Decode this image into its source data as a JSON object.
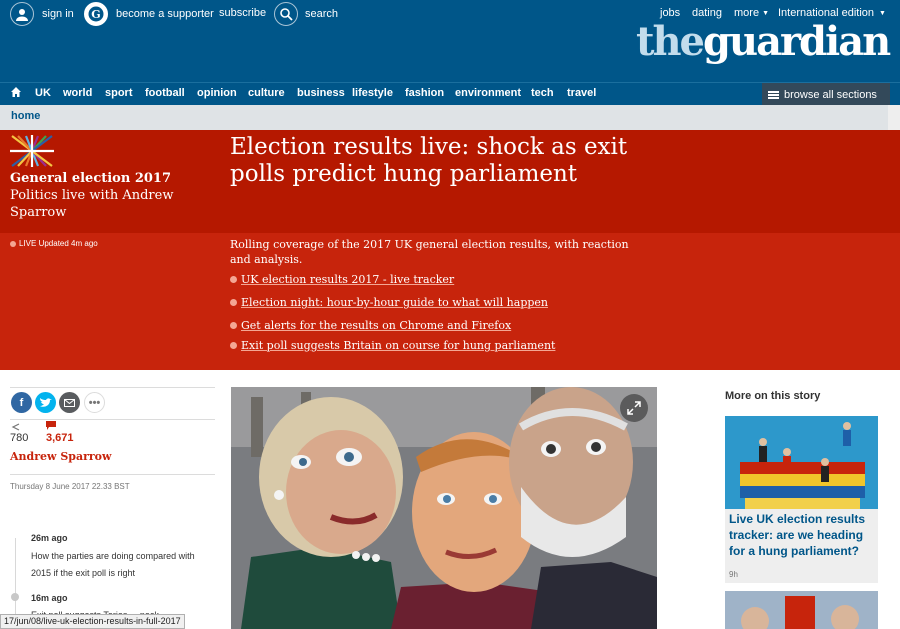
{
  "topbar": {
    "sign_in": "sign in",
    "become_supporter": "become a supporter",
    "subscribe": "subscribe",
    "search": "search",
    "jobs": "jobs",
    "dating": "dating",
    "more": "more",
    "edition": "International edition",
    "logo_the": "the",
    "logo_guardian": "guardian"
  },
  "nav": {
    "items": [
      "UK",
      "world",
      "sport",
      "football",
      "opinion",
      "culture",
      "business",
      "lifestyle",
      "fashion",
      "environment",
      "tech",
      "travel"
    ],
    "browse": "browse all sections"
  },
  "breadcrumb": "home",
  "series": {
    "title": "General election 2017",
    "subtitle": "Politics live with Andrew Sparrow"
  },
  "headline": "Election results live: shock as exit polls predict hung parliament",
  "live_status": "LIVE Updated 4m ago",
  "standfirst": "Rolling coverage of the 2017 UK general election results, with reaction and analysis.",
  "bullets": [
    "UK election results 2017 - live tracker",
    "Election night: hour-by-hour guide to what will happen",
    "Get alerts for the results on Chrome and Firefox",
    "Exit poll suggests Britain on course for hung parliament"
  ],
  "article_meta": {
    "shares": "780",
    "comments": "3,671",
    "author": "Andrew Sparrow",
    "date": "Thursday 8 June 2017 22.33 BST"
  },
  "timeline": [
    {
      "time": "26m ago",
      "text": "How the parties are doing compared with 2015 if the exit poll is right"
    },
    {
      "time": "16m ago",
      "text": "Exit poll suggests Tories ... neck"
    }
  ],
  "more_on_story": {
    "heading": "More on this story",
    "card_title": "Live UK election results tracker: are we heading for a hung parliament?",
    "card_time": "9h"
  },
  "status_url": "17/jun/08/live-uk-election-results-in-full-2017",
  "colors": {
    "brand_blue": "#005689",
    "headline_red": "#b51800",
    "standfirst_red": "#c7240c"
  }
}
